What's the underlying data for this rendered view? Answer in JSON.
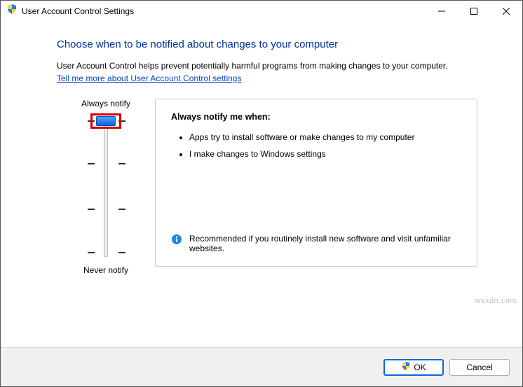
{
  "titlebar": {
    "title": "User Account Control Settings"
  },
  "heading": "Choose when to be notified about changes to your computer",
  "description": "User Account Control helps prevent potentially harmful programs from making changes to your computer.",
  "link": "Tell me more about User Account Control settings",
  "slider": {
    "top_label": "Always notify",
    "bottom_label": "Never notify",
    "level": 3,
    "levels": 4
  },
  "panel": {
    "title": "Always notify me when:",
    "bullets": [
      "Apps try to install software or make changes to my computer",
      "I make changes to Windows settings"
    ],
    "recommendation": "Recommended if you routinely install new software and visit unfamiliar websites."
  },
  "footer": {
    "ok": "OK",
    "cancel": "Cancel"
  },
  "watermark": "wsxdn.com"
}
